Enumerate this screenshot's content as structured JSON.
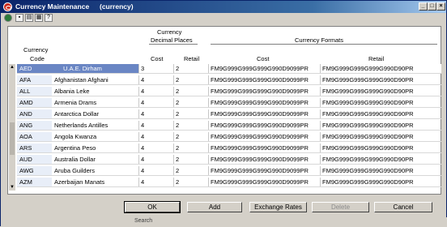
{
  "window": {
    "title": "Currency Maintenance",
    "subtitle": "(currency)"
  },
  "toolbar": {
    "icons": [
      "globe-icon",
      "save-icon",
      "print-icon",
      "export-icon",
      "help-icon"
    ]
  },
  "headers": {
    "currency_code_line1": "Currency",
    "currency_code_line2": "Code",
    "decimal_line1": "Currency",
    "decimal_line2": "Decimal Places",
    "formats": "Currency Formats",
    "cost": "Cost",
    "retail": "Retail",
    "fmt_cost": "Cost",
    "fmt_retail": "Retail"
  },
  "rows": [
    {
      "code": "AED",
      "name": "U.A.E. Dirham",
      "cost": "3",
      "retail": "2",
      "fmt_cost": "FM9G999G999G999G990D9099PR",
      "fmt_retail": "FM9G999G999G999G990D90PR"
    },
    {
      "code": "AFA",
      "name": "Afghanistan Afghani",
      "cost": "4",
      "retail": "2",
      "fmt_cost": "FM9G999G999G999G990D9099PR",
      "fmt_retail": "FM9G999G999G999G990D90PR"
    },
    {
      "code": "ALL",
      "name": "Albania Leke",
      "cost": "4",
      "retail": "2",
      "fmt_cost": "FM9G999G999G999G990D9099PR",
      "fmt_retail": "FM9G999G999G999G990D90PR"
    },
    {
      "code": "AMD",
      "name": "Armenia Drams",
      "cost": "4",
      "retail": "2",
      "fmt_cost": "FM9G999G999G999G990D9099PR",
      "fmt_retail": "FM9G999G999G999G990D90PR"
    },
    {
      "code": "AND",
      "name": "Antarctica Dollar",
      "cost": "4",
      "retail": "2",
      "fmt_cost": "FM9G999G999G999G990D9099PR",
      "fmt_retail": "FM9G999G999G999G990D90PR"
    },
    {
      "code": "ANG",
      "name": "Netherlands Antilles",
      "cost": "4",
      "retail": "2",
      "fmt_cost": "FM9G999G999G999G990D9099PR",
      "fmt_retail": "FM9G999G999G999G990D90PR"
    },
    {
      "code": "AOA",
      "name": "Angola Kwanza",
      "cost": "4",
      "retail": "2",
      "fmt_cost": "FM9G999G999G999G990D9099PR",
      "fmt_retail": "FM9G999G999G999G990D90PR"
    },
    {
      "code": "ARS",
      "name": "Argentina Peso",
      "cost": "4",
      "retail": "2",
      "fmt_cost": "FM9G999G999G999G990D9099PR",
      "fmt_retail": "FM9G999G999G999G990D90PR"
    },
    {
      "code": "AUD",
      "name": "Australia Dollar",
      "cost": "4",
      "retail": "2",
      "fmt_cost": "FM9G999G999G999G990D9099PR",
      "fmt_retail": "FM9G999G999G999G990D90PR"
    },
    {
      "code": "AWG",
      "name": "Aruba Guilders",
      "cost": "4",
      "retail": "2",
      "fmt_cost": "FM9G999G999G999G990D9099PR",
      "fmt_retail": "FM9G999G999G999G990D90PR"
    },
    {
      "code": "AZM",
      "name": "Azerbaijan Manats",
      "cost": "4",
      "retail": "2",
      "fmt_cost": "FM9G999G999G999G990D9099PR",
      "fmt_retail": "FM9G999G999G999G990D90PR"
    }
  ],
  "buttons": {
    "ok": "OK",
    "add": "Add",
    "exchange_rates": "Exchange Rates",
    "delete": "Delete",
    "cancel": "Cancel"
  },
  "status": {
    "text": "Search"
  },
  "colors": {
    "titlebar": "#0a246a",
    "selected_row": "#6a86c4",
    "dialog_bg": "#d4d0c8"
  }
}
